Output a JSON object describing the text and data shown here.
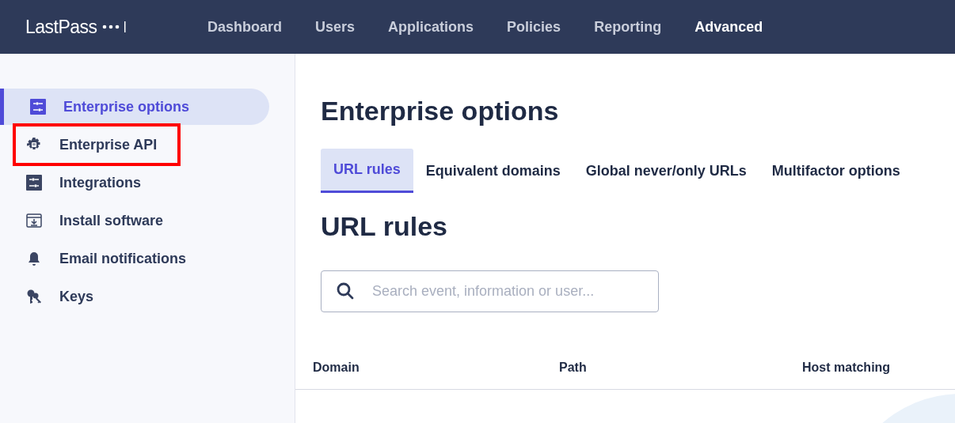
{
  "header": {
    "logo": "LastPass",
    "nav": [
      {
        "label": "Dashboard",
        "selected": false
      },
      {
        "label": "Users",
        "selected": false
      },
      {
        "label": "Applications",
        "selected": false
      },
      {
        "label": "Policies",
        "selected": false
      },
      {
        "label": "Reporting",
        "selected": false
      },
      {
        "label": "Advanced",
        "selected": true
      }
    ]
  },
  "sidebar": {
    "items": [
      {
        "label": "Enterprise options",
        "kind": "sliders",
        "selected": true,
        "highlighted": false
      },
      {
        "label": "Enterprise API",
        "kind": "gear",
        "selected": false,
        "highlighted": true
      },
      {
        "label": "Integrations",
        "kind": "sliders",
        "selected": false,
        "highlighted": false
      },
      {
        "label": "Install software",
        "kind": "download",
        "selected": false,
        "highlighted": false
      },
      {
        "label": "Email notifications",
        "kind": "bell",
        "selected": false,
        "highlighted": false
      },
      {
        "label": "Keys",
        "kind": "keys",
        "selected": false,
        "highlighted": false
      }
    ]
  },
  "main": {
    "title": "Enterprise options",
    "tabs": [
      {
        "label": "URL rules",
        "selected": true
      },
      {
        "label": "Equivalent domains",
        "selected": false
      },
      {
        "label": "Global never/only URLs",
        "selected": false
      },
      {
        "label": "Multifactor options",
        "selected": false
      }
    ],
    "section_title": "URL rules",
    "search": {
      "placeholder": "Search event, information or user..."
    },
    "table": {
      "columns": [
        "Domain",
        "Path",
        "Host matching"
      ]
    }
  }
}
